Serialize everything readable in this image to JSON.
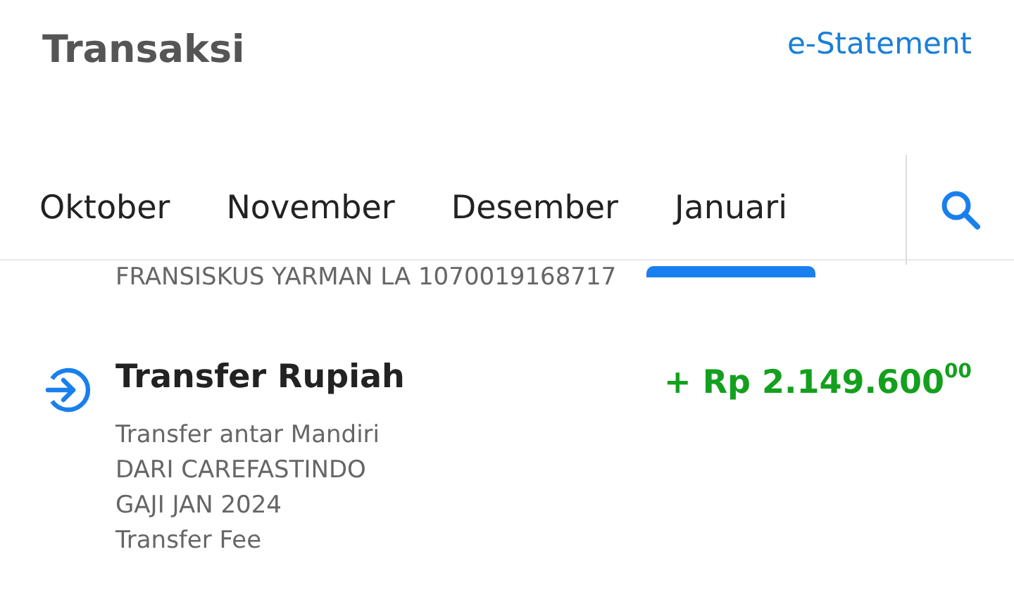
{
  "header": {
    "title": "Transaksi",
    "link": "e-Statement"
  },
  "tabs": [
    {
      "label": "Oktober",
      "selected": false
    },
    {
      "label": "November",
      "selected": false
    },
    {
      "label": "Desember",
      "selected": false
    },
    {
      "label": "Januari",
      "selected": true
    }
  ],
  "previous_note": "FRANSISKUS YARMAN LA 1070019168717",
  "transactions": [
    {
      "kind": "incoming",
      "title": "Transfer Rupiah",
      "amount": "+ Rp 2.149.600$^{00}$",
      "details": [
        "Transfer antar Mandiri",
        "DARI CAREFASTINDO",
        "GAJI JAN 2024",
        "Transfer Fee"
      ]
    }
  ]
}
